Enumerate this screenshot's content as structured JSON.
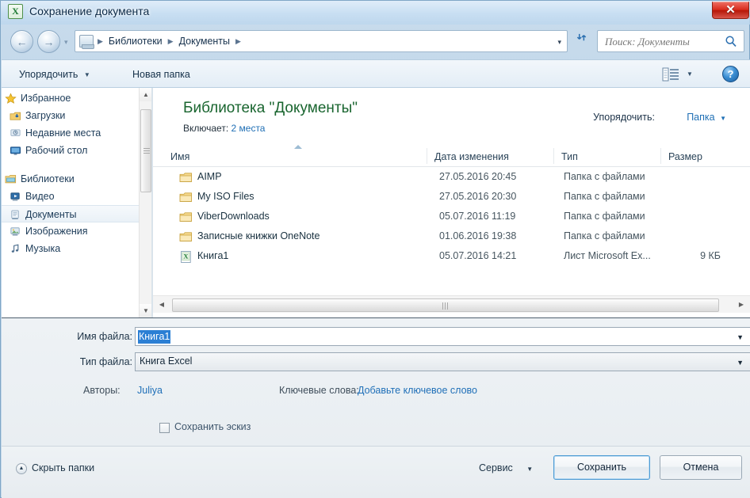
{
  "window": {
    "title": "Сохранение документа",
    "app_icon": "excel-icon",
    "close_label": "✕"
  },
  "navbar": {
    "back_icon": "arrow-left-icon",
    "forward_icon": "arrow-right-icon",
    "history_caret": "▾",
    "breadcrumb": {
      "icon": "library-icon",
      "items": [
        "Библиотеки",
        "Документы"
      ],
      "separator": "▶",
      "caret": "▾"
    },
    "refresh_icon": "refresh-icon",
    "search": {
      "placeholder": "Поиск: Документы",
      "icon": "search-icon"
    }
  },
  "toolbar": {
    "organize_label": "Упорядочить",
    "organize_caret": "▼",
    "new_folder_label": "Новая папка",
    "view_icon": "list-view-icon",
    "view_caret": "▼",
    "help_label": "?"
  },
  "sidebar": {
    "groups": [
      {
        "root": {
          "label": "Избранное",
          "icon": "star-icon"
        },
        "items": [
          {
            "label": "Загрузки",
            "icon": "downloads-icon"
          },
          {
            "label": "Недавние места",
            "icon": "recent-places-icon"
          },
          {
            "label": "Рабочий стол",
            "icon": "desktop-icon"
          }
        ]
      },
      {
        "root": {
          "label": "Библиотеки",
          "icon": "libraries-icon"
        },
        "items": [
          {
            "label": "Видео",
            "icon": "video-library-icon"
          },
          {
            "label": "Документы",
            "icon": "documents-library-icon",
            "selected": true
          },
          {
            "label": "Изображения",
            "icon": "pictures-library-icon"
          },
          {
            "label": "Музыка",
            "icon": "music-library-icon"
          }
        ]
      }
    ],
    "scroll_up_icon": "▲",
    "scroll_down_icon": "▼"
  },
  "content": {
    "library_title": "Библиотека \"Документы\"",
    "includes_label": "Включает:",
    "includes_value": "2 места",
    "arrange_label": "Упорядочить:",
    "arrange_value": "Папка",
    "arrange_caret": "▼",
    "columns": [
      {
        "label": "Имя"
      },
      {
        "label": "Дата изменения"
      },
      {
        "label": "Тип"
      },
      {
        "label": "Размер"
      }
    ],
    "sort_indicator": "ascending",
    "rows": [
      {
        "icon": "folder-icon",
        "name": "AIMP",
        "date": "27.05.2016 20:45",
        "type": "Папка с файлами",
        "size": ""
      },
      {
        "icon": "folder-icon",
        "name": "My ISO Files",
        "date": "27.05.2016 20:30",
        "type": "Папка с файлами",
        "size": ""
      },
      {
        "icon": "folder-icon",
        "name": "ViberDownloads",
        "date": "05.07.2016 11:19",
        "type": "Папка с файлами",
        "size": ""
      },
      {
        "icon": "folder-icon",
        "name": "Записные книжки OneNote",
        "date": "01.06.2016 19:38",
        "type": "Папка с файлами",
        "size": ""
      },
      {
        "icon": "excel-file-icon",
        "name": "Книга1",
        "date": "05.07.2016 14:21",
        "type": "Лист Microsoft Ex...",
        "size": "9 КБ"
      }
    ],
    "hscroll_left_icon": "◀",
    "hscroll_right_icon": "▶"
  },
  "form": {
    "filename_label": "Имя файла:",
    "filename_value": "Книга1",
    "filename_caret": "▼",
    "filetype_label": "Тип файла:",
    "filetype_value": "Книга Excel",
    "filetype_caret": "▼",
    "authors_label": "Авторы:",
    "authors_value": "Juliya",
    "tags_label": "Ключевые слова:",
    "tags_value": "Добавьте ключевое слово",
    "thumbnail_label": "Сохранить эскиз",
    "thumbnail_checked": false
  },
  "footer": {
    "hide_folders_label": "Скрыть папки",
    "hide_folders_icon": "▲",
    "tools_label": "Сервис",
    "tools_caret": "▼",
    "save_label": "Сохранить",
    "cancel_label": "Отмена"
  },
  "colors": {
    "accent_link": "#2070b8",
    "library_title": "#19652f",
    "selection": "#2b7fd4",
    "close_button": "#d92c1d",
    "default_button_border": "#4e9bd4"
  }
}
